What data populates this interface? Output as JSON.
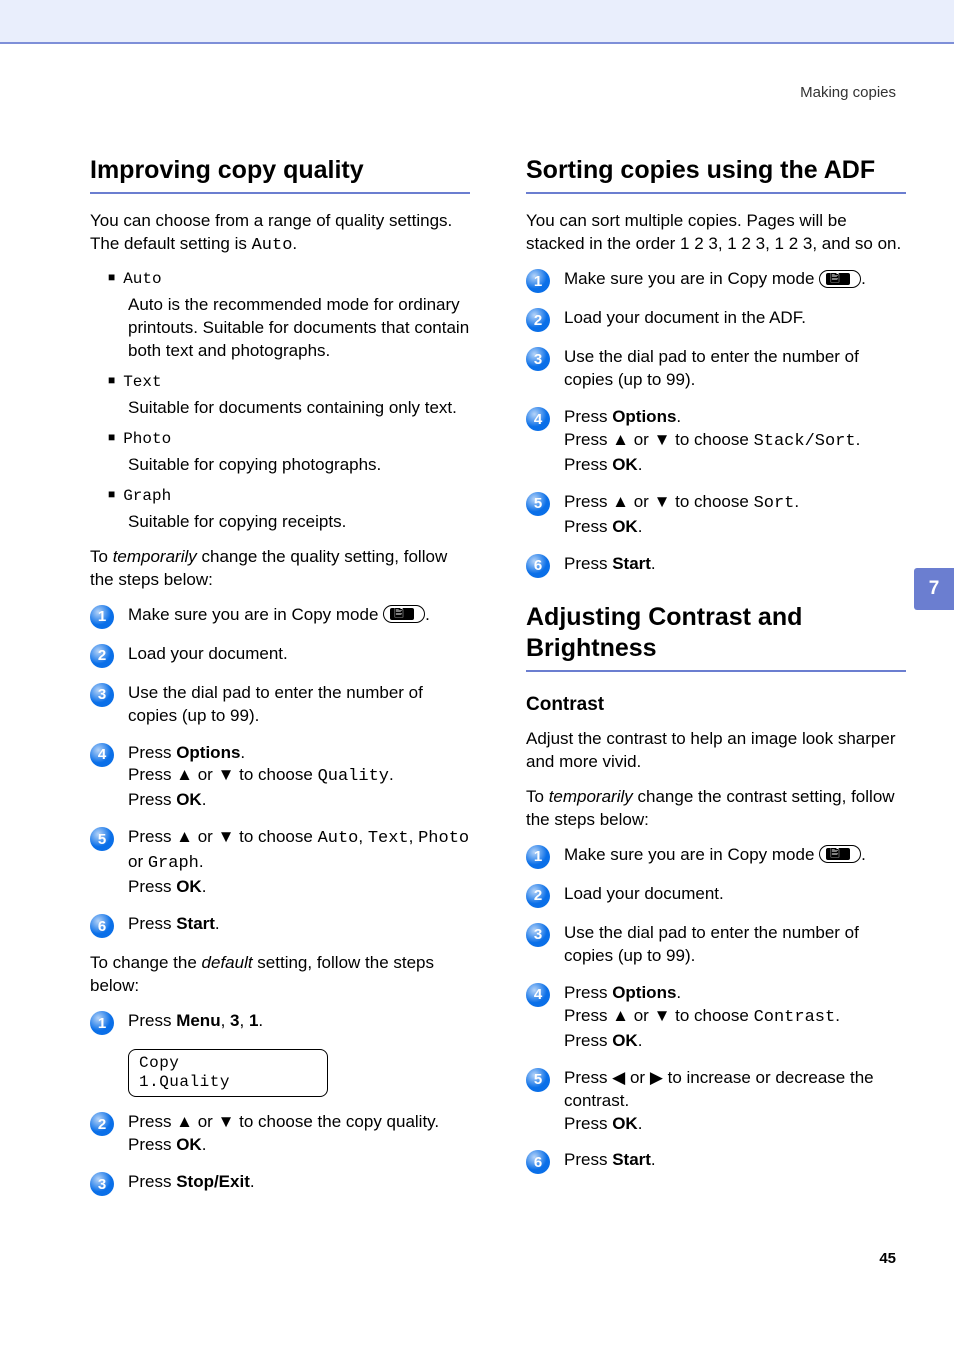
{
  "breadcrumb": "Making copies",
  "chapter_tab": "7",
  "page_number": "45",
  "left": {
    "h_improving": "Improving copy quality",
    "intro_a": "You can choose from a range of quality settings. The default setting is ",
    "intro_b": "Auto",
    "intro_c": ".",
    "bullets": {
      "auto_head": "Auto",
      "auto_body": "Auto is the recommended mode for ordinary printouts. Suitable for documents that contain both text and photographs.",
      "text_head": "Text",
      "text_body": "Suitable for documents containing only text.",
      "photo_head": "Photo",
      "photo_body": "Suitable for copying photographs.",
      "graph_head": "Graph",
      "graph_body": "Suitable for copying receipts."
    },
    "temp_a": "To ",
    "temp_b": "temporarily",
    "temp_c": " change the quality setting, follow the steps below:",
    "s1": {
      "a": "Make sure you are in Copy mode ",
      "b": "."
    },
    "s2": "Load your document.",
    "s3": "Use the dial pad to enter the number of copies (up to 99).",
    "s4": {
      "a": "Press ",
      "b": "Options",
      "c": ".",
      "d": "Press ▲ or ▼ to choose ",
      "e": "Quality",
      "f": ".",
      "g": "Press ",
      "h": "OK",
      "i": "."
    },
    "s5": {
      "a": "Press ▲ or ▼ to choose ",
      "b": "Auto",
      "c": ", ",
      "d": "Text",
      "e": ", ",
      "f": "Photo",
      "g": " or ",
      "h": "Graph",
      "i": ".",
      "j": "Press ",
      "k": "OK",
      "l": "."
    },
    "s6": {
      "a": "Press ",
      "b": "Start",
      "c": "."
    },
    "default_a": "To change the ",
    "default_b": "default",
    "default_c": " setting, follow the steps below:",
    "d1": {
      "a": "Press ",
      "b": "Menu",
      "c": ", ",
      "d": "3",
      "e": ", ",
      "f": "1",
      "g": "."
    },
    "lcd_line1": "Copy",
    "lcd_line2": "1.Quality",
    "d2": {
      "a": "Press ▲ or ▼ to choose the copy quality. Press ",
      "b": "OK",
      "c": "."
    },
    "d3": {
      "a": "Press ",
      "b": "Stop/Exit",
      "c": "."
    }
  },
  "right": {
    "h_sorting": "Sorting copies using the ADF",
    "sort_intro": "You can sort multiple copies. Pages will be stacked in the order 1 2 3, 1 2 3, 1 2 3, and so on.",
    "a1": {
      "a": "Make sure you are in Copy mode ",
      "b": "."
    },
    "a2": "Load your document in the ADF.",
    "a3": "Use the dial pad to enter the number of copies (up to 99).",
    "a4": {
      "a": "Press ",
      "b": "Options",
      "c": ".",
      "d": "Press ▲ or ▼ to choose ",
      "e": "Stack/Sort",
      "f": ".",
      "g": "Press ",
      "h": "OK",
      "i": "."
    },
    "a5": {
      "a": "Press ▲ or ▼ to choose ",
      "b": "Sort",
      "c": ".",
      "d": "Press ",
      "e": "OK",
      "f": "."
    },
    "a6": {
      "a": "Press ",
      "b": "Start",
      "c": "."
    },
    "h_adjusting": "Adjusting Contrast and Brightness",
    "h_contrast": "Contrast",
    "contrast_intro": "Adjust the contrast to help an image look sharper and more vivid.",
    "ctemp_a": "To ",
    "ctemp_b": "temporarily",
    "ctemp_c": " change the contrast setting, follow the steps below:",
    "c1": {
      "a": "Make sure you are in Copy mode ",
      "b": "."
    },
    "c2": "Load your document.",
    "c3": "Use the dial pad to enter the number of copies (up to 99).",
    "c4": {
      "a": "Press ",
      "b": "Options",
      "c": ".",
      "d": "Press ▲ or ▼ to choose ",
      "e": "Contrast",
      "f": ".",
      "g": "Press ",
      "h": "OK",
      "i": "."
    },
    "c5": {
      "a": "Press ◀ or ▶ to increase or decrease the contrast.",
      "b": "Press ",
      "c": "OK",
      "d": "."
    },
    "c6": {
      "a": "Press ",
      "b": "Start",
      "c": "."
    }
  }
}
